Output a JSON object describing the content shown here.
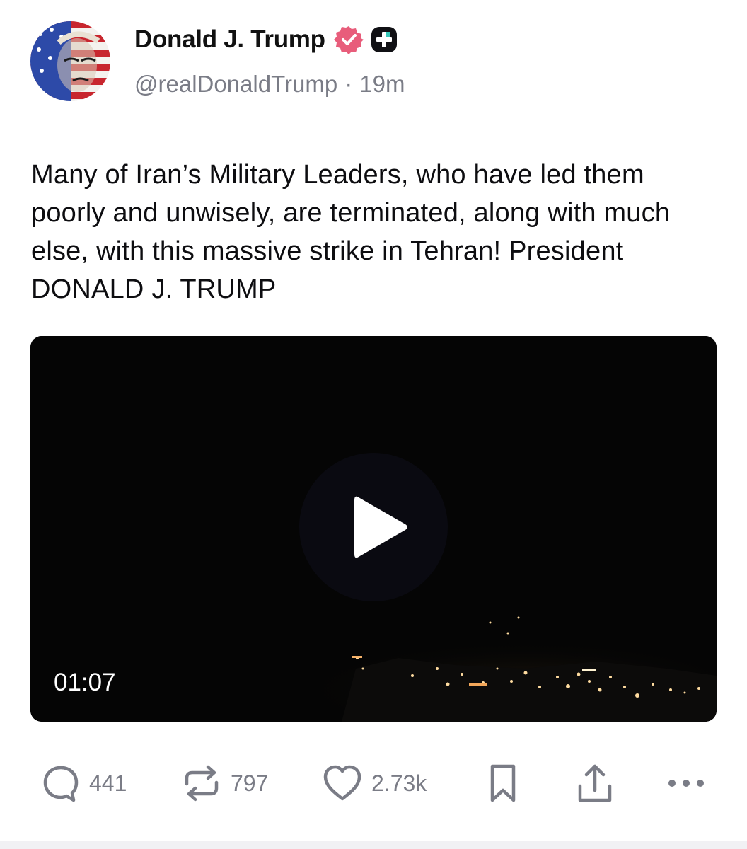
{
  "post": {
    "author": {
      "display_name": "Donald J. Trump",
      "handle": "@realDonaldTrump",
      "time_ago": "19m",
      "separator": "·"
    },
    "text": "Many of Iran’s Military Leaders, who have led them poorly and unwisely, are terminated, along with much else, with this massive strike in Tehran! President DONALD J. TRUMP",
    "video": {
      "duration": "01:07"
    },
    "actions": {
      "replies": "441",
      "reposts": "797",
      "likes": "2.73k"
    }
  },
  "colors": {
    "verified_badge": "#e85d7b",
    "secondary_text": "#7a7c86",
    "video_background": "#050505"
  },
  "icons": [
    "verified-badge-icon",
    "plus-badge-icon",
    "reply-icon",
    "repost-icon",
    "like-icon",
    "bookmark-icon",
    "share-icon",
    "more-icon",
    "play-icon"
  ]
}
